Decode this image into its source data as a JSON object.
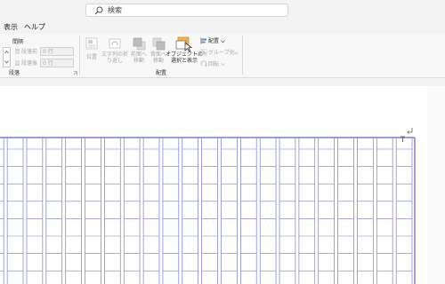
{
  "search": {
    "placeholder": "検索"
  },
  "menu": {
    "items": [
      {
        "label": "表示"
      },
      {
        "label": "ヘルプ"
      }
    ]
  },
  "ribbon": {
    "paragraph": {
      "spacing_label": "間隔",
      "before_label": "段落前",
      "before_value": "0 行",
      "after_label": "段落後",
      "after_value": "0 行",
      "group_label": "段落"
    },
    "arrange": {
      "position_label": "位置",
      "wrap_line1": "文字列の折",
      "wrap_line2": "り返し",
      "forward_line1": "前面へ",
      "forward_line2": "移動",
      "backward_line1": "背面へ",
      "backward_line2": "移動",
      "select_line1": "オブジェクトの",
      "select_line2": "選択と表示",
      "align_label": "配置",
      "group_btn_label": "グループ化",
      "rotate_label": "回転",
      "group_label": "配置"
    }
  },
  "colors": {
    "grid": "#7b7bd6",
    "accent": "#e8a33c",
    "ribbon": "#f8f8f8",
    "chrome": "#f3f3f3"
  },
  "document": {
    "columns": 26,
    "rows": 9
  }
}
